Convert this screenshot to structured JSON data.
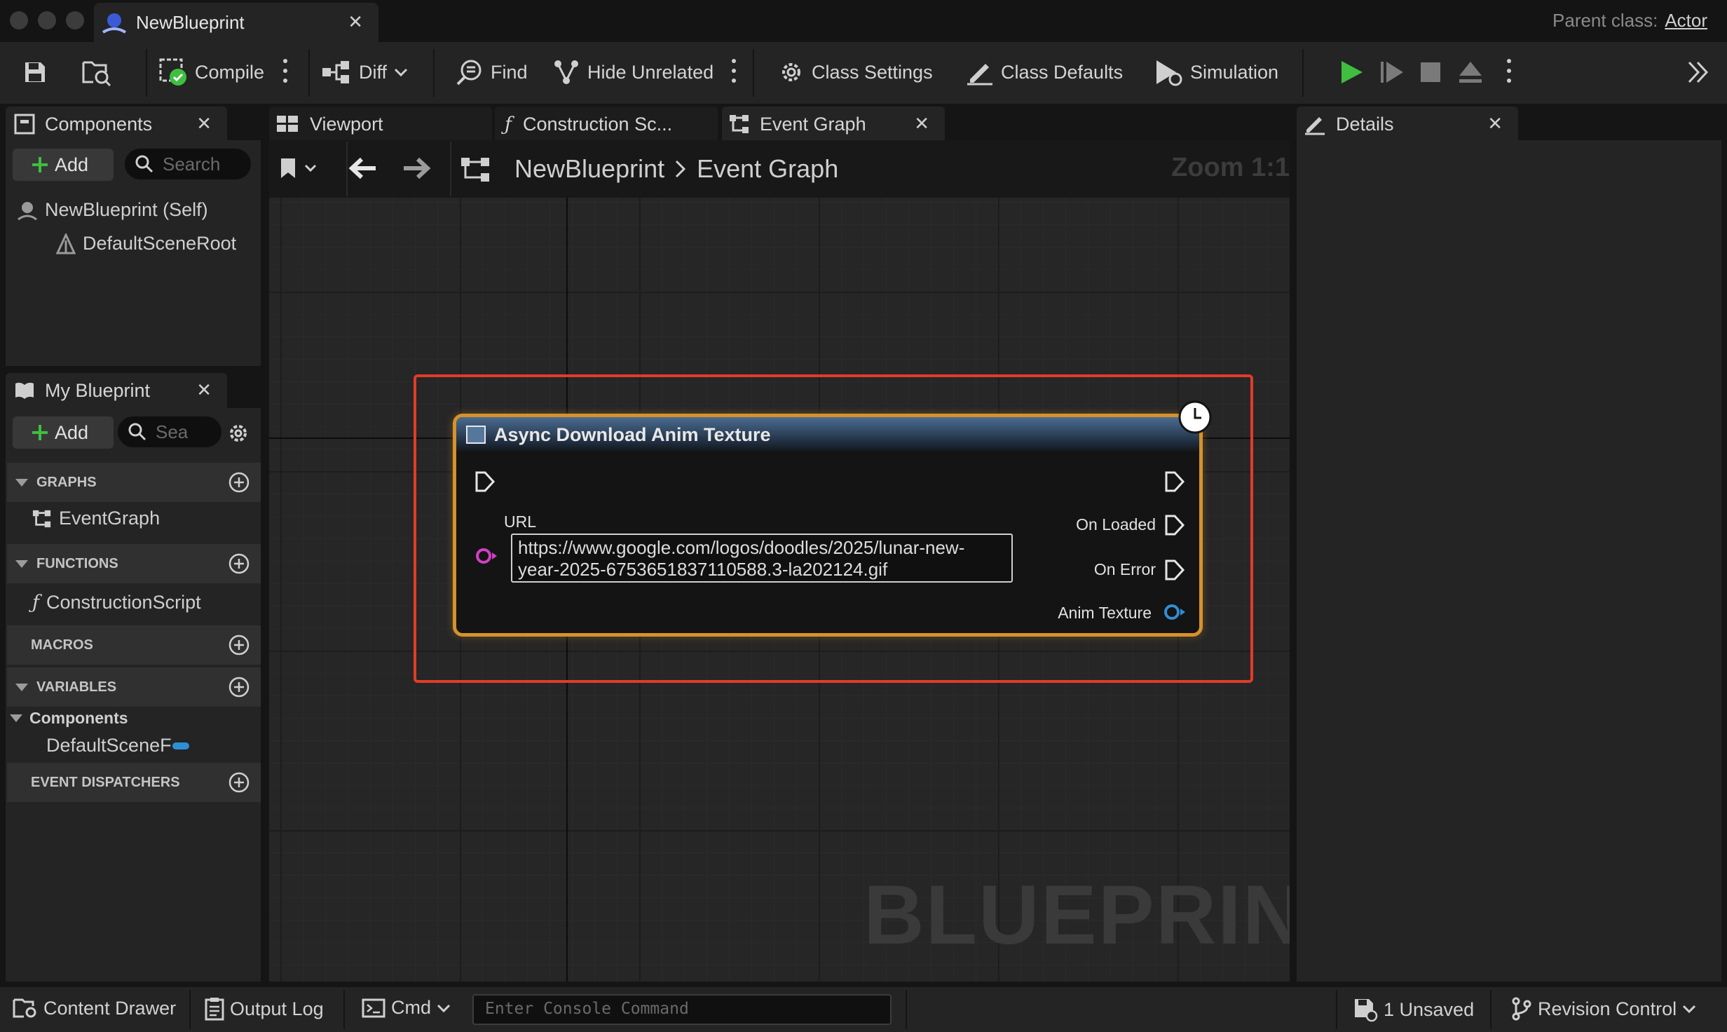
{
  "window": {
    "document_tab": "NewBlueprint",
    "parent_class_label": "Parent class:",
    "parent_class_value": "Actor"
  },
  "toolbar": {
    "compile": "Compile",
    "diff": "Diff",
    "find": "Find",
    "hide_unrelated": "Hide Unrelated",
    "class_settings": "Class Settings",
    "class_defaults": "Class Defaults",
    "simulation": "Simulation"
  },
  "panel_tabs": {
    "components": "Components",
    "viewport": "Viewport",
    "construction_script": "Construction Sc...",
    "event_graph": "Event Graph",
    "details": "Details",
    "my_blueprint": "My Blueprint"
  },
  "components_panel": {
    "add_label": "Add",
    "search_placeholder": "Search",
    "items": [
      "NewBlueprint (Self)",
      "DefaultSceneRoot"
    ]
  },
  "my_blueprint": {
    "add_label": "Add",
    "search_placeholder": "Sea",
    "sections": {
      "graphs": "GRAPHS",
      "functions": "FUNCTIONS",
      "macros": "MACROS",
      "variables": "VARIABLES",
      "event_dispatchers": "EVENT DISPATCHERS"
    },
    "graph_item": "EventGraph",
    "function_item": "ConstructionScript",
    "variables_category": "Components",
    "variable_item": "DefaultSceneF"
  },
  "graph": {
    "breadcrumb": [
      "NewBlueprint",
      "Event Graph"
    ],
    "zoom": "Zoom 1:1",
    "watermark": "BLUEPRINT"
  },
  "node": {
    "title": "Async Download Anim Texture",
    "url_label": "URL",
    "url_value": "https://www.google.com/logos/doodles/2025/lunar-new-year-2025-6753651837110588.3-la202124.gif",
    "outputs": [
      "On Loaded",
      "On Error",
      "Anim Texture"
    ]
  },
  "statusbar": {
    "content_drawer": "Content Drawer",
    "output_log": "Output Log",
    "cmd": "Cmd",
    "console_placeholder": "Enter Console Command",
    "unsaved": "1 Unsaved",
    "revision_control": "Revision Control"
  },
  "colors": {
    "node_border": "#d7922a",
    "highlight": "#e03c2a",
    "exec_pin": "#e6e6e6",
    "string_pin": "#d23fc7",
    "object_pin": "#2e8fd6",
    "play_green": "#3fbf3f"
  }
}
